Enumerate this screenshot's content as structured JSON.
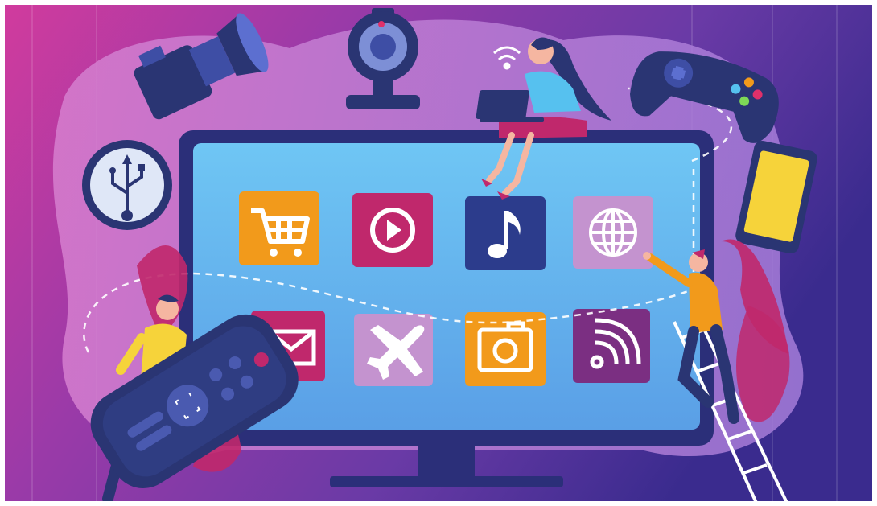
{
  "scene": {
    "subject": "smart-tv-illustration",
    "colors": {
      "background_left": "#d13a9c",
      "background_right": "#3b2a8c",
      "screen": "#63b7ef",
      "tv_frame": "#2b2f79",
      "remote": "#2a3573",
      "accent_orange": "#f29a1b",
      "accent_pink": "#c0286c"
    }
  },
  "app_tiles": [
    {
      "icon": "shopping-cart-icon",
      "color": "#f29a1b"
    },
    {
      "icon": "play-icon",
      "color": "#c0286c"
    },
    {
      "icon": "music-note-icon",
      "color": "#2c3c8c"
    },
    {
      "icon": "globe-icon",
      "color": "#c493cf"
    },
    {
      "icon": "mail-icon",
      "color": "#c0286c"
    },
    {
      "icon": "airplane-icon",
      "color": "#c493cf"
    },
    {
      "icon": "camera-icon",
      "color": "#f29a1b"
    },
    {
      "icon": "rss-icon",
      "color": "#7b2f82"
    }
  ],
  "devices": [
    "camera-icon",
    "webcam-icon",
    "laptop-icon",
    "gamepad-icon",
    "usb-icon",
    "tablet-icon",
    "remote-control-icon"
  ]
}
